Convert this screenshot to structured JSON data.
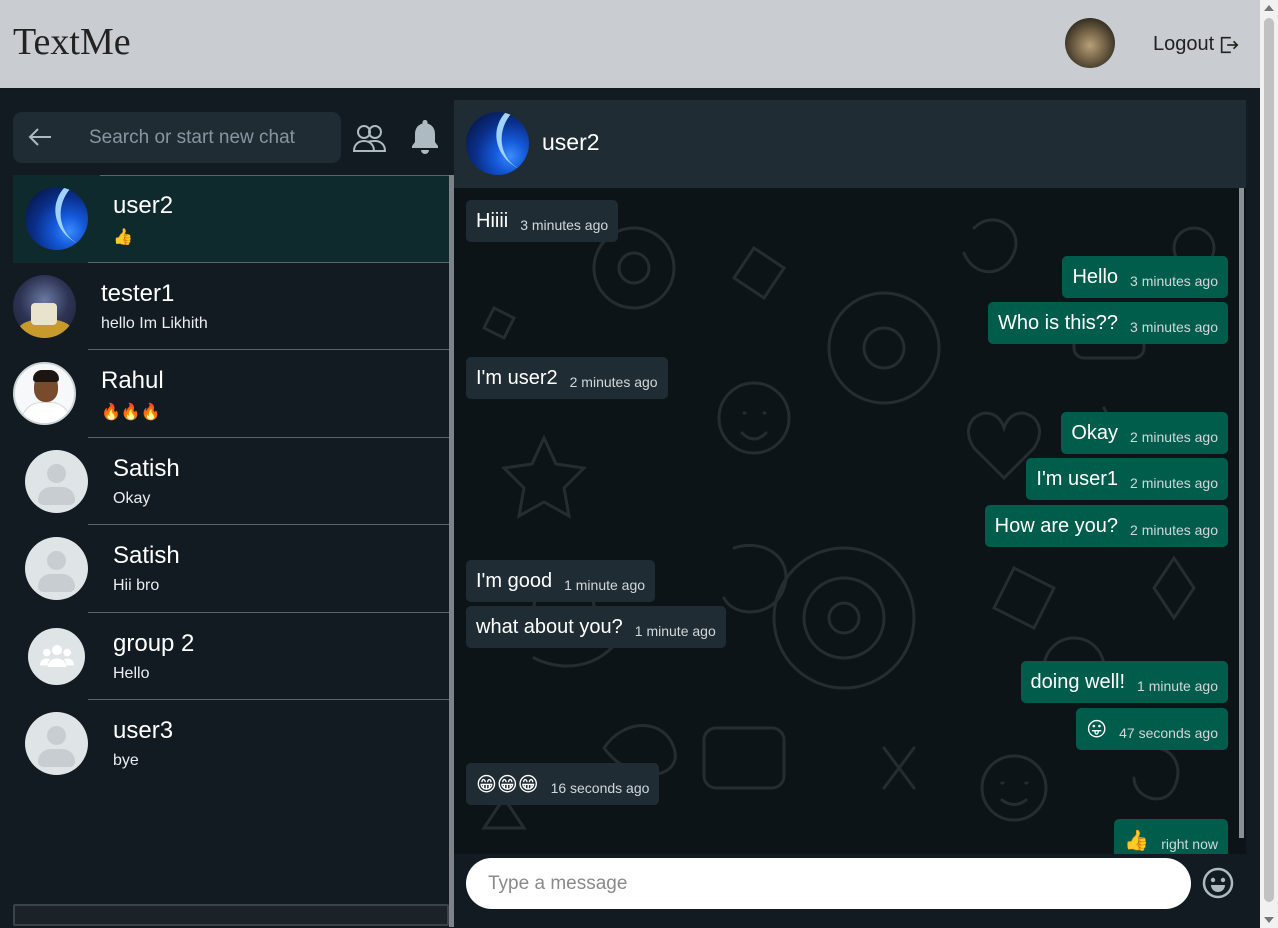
{
  "app": {
    "title": "TextMe"
  },
  "header": {
    "logout_label": "Logout"
  },
  "search": {
    "placeholder": "Search or start new chat"
  },
  "chats": [
    {
      "name": "user2",
      "last": "👍",
      "avatar": "blue-abstract"
    },
    {
      "name": "tester1",
      "last": "hello Im Likhith",
      "avatar": "photo"
    },
    {
      "name": "Rahul",
      "last": "🔥🔥🔥",
      "avatar": "photo"
    },
    {
      "name": "Satish",
      "last": "Okay",
      "avatar": "default"
    },
    {
      "name": "Satish",
      "last": "Hii bro",
      "avatar": "default"
    },
    {
      "name": "group 2",
      "last": "Hello",
      "avatar": "group"
    },
    {
      "name": "user3",
      "last": "bye",
      "avatar": "default"
    }
  ],
  "conversation": {
    "title": "user2",
    "messages": [
      {
        "dir": "in",
        "text": "Hiiii",
        "time": "3 minutes ago"
      },
      {
        "dir": "out",
        "text": "Hello",
        "time": "3 minutes ago"
      },
      {
        "dir": "out",
        "text": "Who is this??",
        "time": "3 minutes ago"
      },
      {
        "dir": "in",
        "text": "I'm user2",
        "time": "2 minutes ago"
      },
      {
        "dir": "out",
        "text": "Okay",
        "time": "2 minutes ago"
      },
      {
        "dir": "out",
        "text": "I'm user1",
        "time": "2 minutes ago"
      },
      {
        "dir": "out",
        "text": "How are you?",
        "time": "2 minutes ago"
      },
      {
        "dir": "in",
        "text": "I'm good",
        "time": "1 minute ago"
      },
      {
        "dir": "in",
        "text": "what about you?",
        "time": "1 minute ago"
      },
      {
        "dir": "out",
        "text": "doing well!",
        "time": "1 minute ago"
      },
      {
        "dir": "out",
        "text": "😛",
        "time": "47 seconds ago"
      },
      {
        "dir": "in",
        "text": "😁😁😁",
        "time": "16 seconds ago"
      },
      {
        "dir": "out",
        "text": "👍",
        "time": "right now"
      }
    ]
  },
  "composer": {
    "placeholder": "Type a message"
  },
  "colors": {
    "incoming": "#202c33",
    "outgoing": "#005c4b",
    "sidebar": "#111b21",
    "topbar": "#c9ccd0"
  }
}
